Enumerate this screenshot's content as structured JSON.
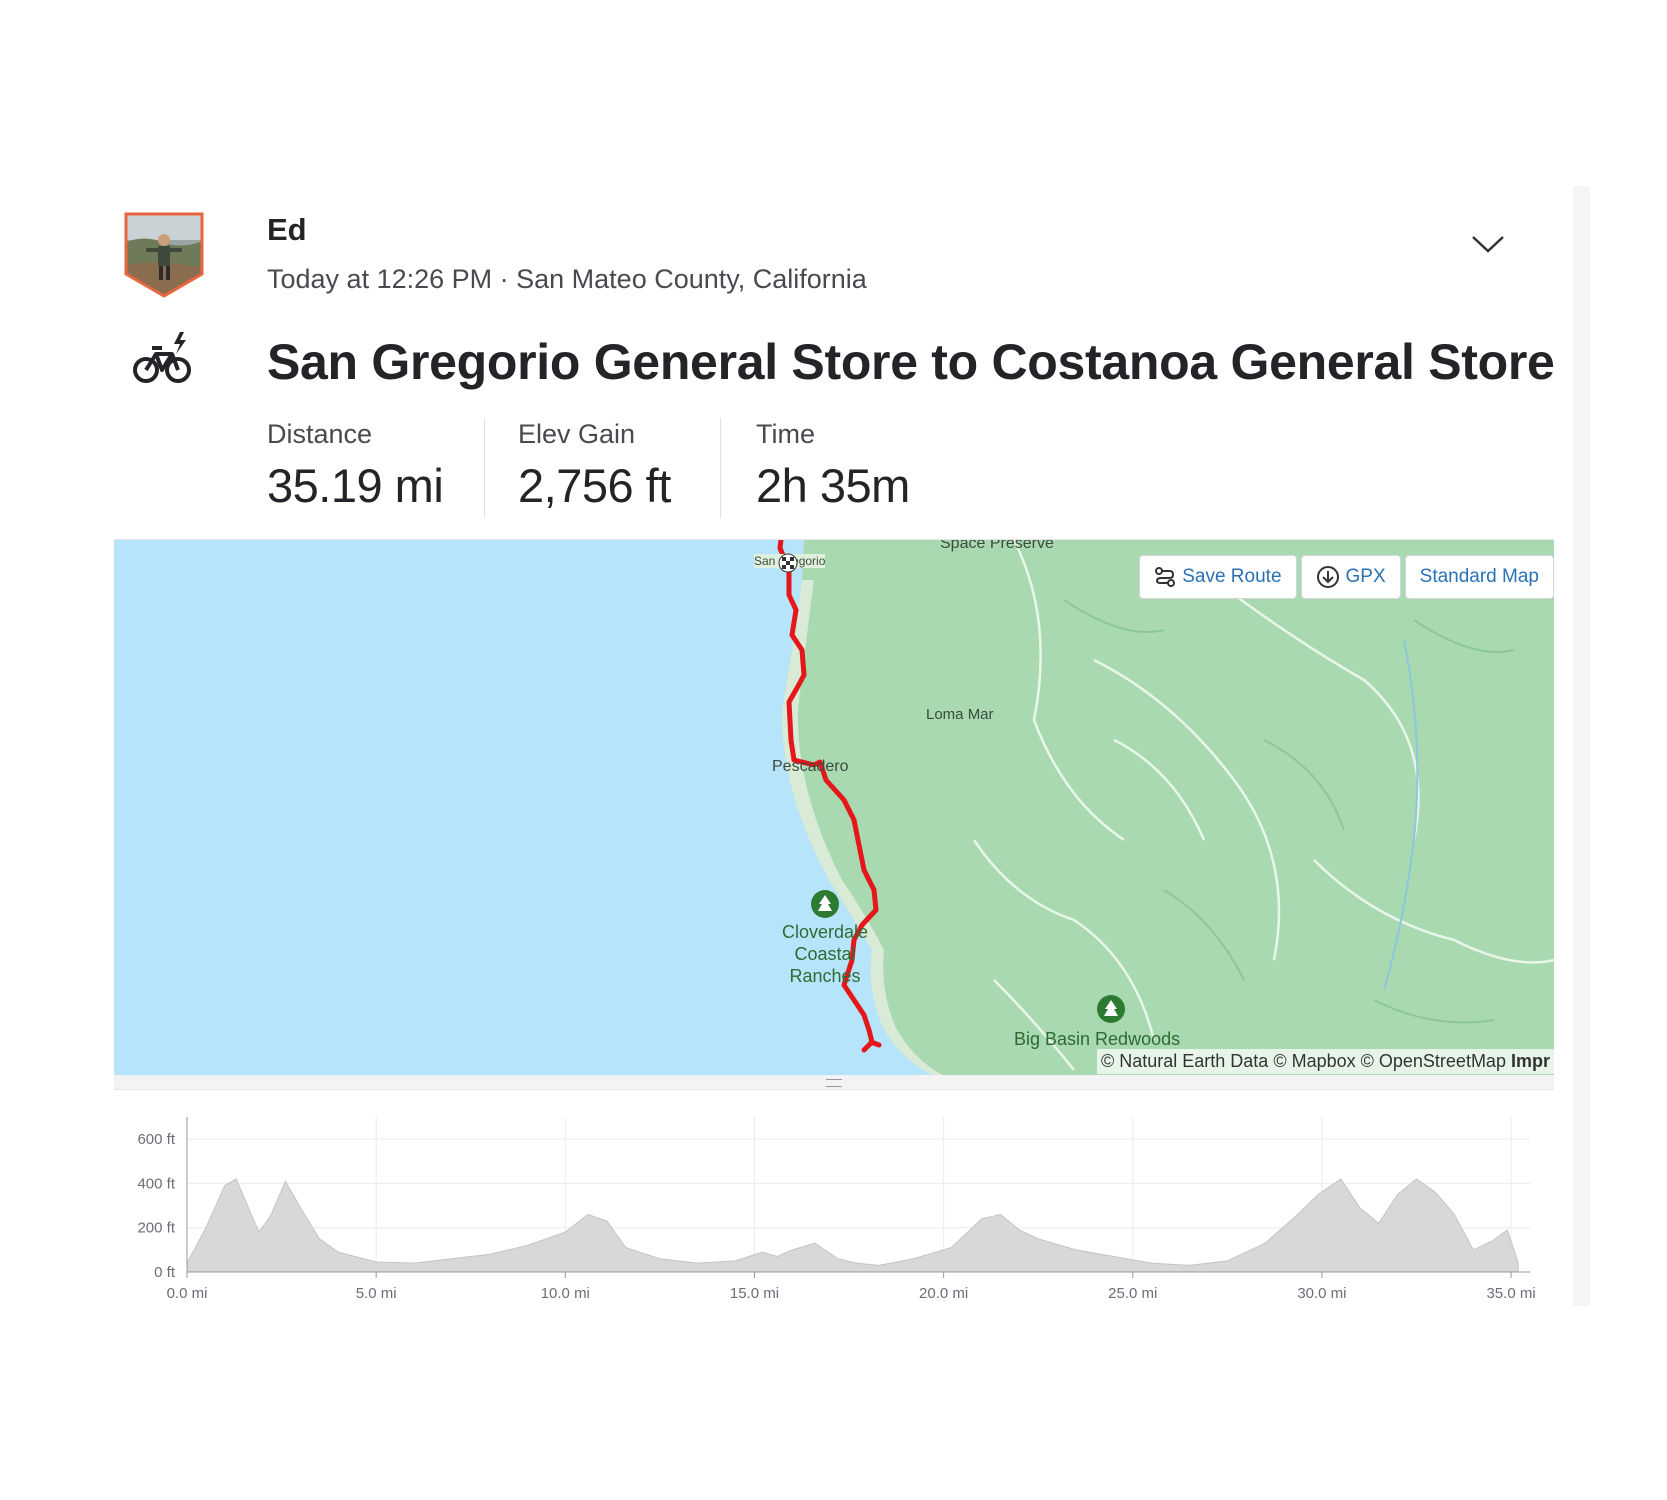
{
  "athlete": {
    "name": "Ed",
    "avatar": "athlete-avatar-photo"
  },
  "activity": {
    "meta": "Today at 12:26 PM · San Mateo County, California",
    "sport_icon": "ebike-icon",
    "title": "San Gregorio General Store to Costanoa General Store"
  },
  "stats": [
    {
      "label": "Distance",
      "value": "35.19 mi"
    },
    {
      "label": "Elev Gain",
      "value": "2,756 ft"
    },
    {
      "label": "Time",
      "value": "2h 35m"
    }
  ],
  "map": {
    "buttons": {
      "save_route": "Save Route",
      "gpx": "GPX",
      "standard_map": "Standard Map"
    },
    "labels": {
      "space_preserve": "Space Preserve",
      "san_gregorio": "San Gregorio",
      "loma_mar": "Loma Mar",
      "pescadero": "Pescadero",
      "cloverdale": "Cloverdale Coastal Ranches",
      "big_basin": "Big Basin Redwoods"
    },
    "attribution": "© Natural Earth Data © Mapbox © OpenStreetMap",
    "attribution_more": "Impr",
    "colors": {
      "ocean": "#b6e4fa",
      "land": "#a8d9b1",
      "route": "#e4171b"
    }
  },
  "chart_data": {
    "type": "area",
    "x_unit": "mi",
    "y_unit": "ft",
    "xlim": [
      0,
      35.19
    ],
    "ylim": [
      0,
      700
    ],
    "y_ticks": [
      "0 ft",
      "200 ft",
      "400 ft",
      "600 ft"
    ],
    "x_ticks": [
      "0.0 mi",
      "5.0 mi",
      "10.0 mi",
      "15.0 mi",
      "20.0 mi",
      "25.0 mi",
      "30.0 mi",
      "35.0 mi"
    ],
    "y_tick_values": [
      0,
      200,
      400,
      600
    ],
    "x_tick_values": [
      0,
      5,
      10,
      15,
      20,
      25,
      30,
      35
    ],
    "grid": true,
    "x": [
      0,
      0.5,
      1,
      1.3,
      1.6,
      1.9,
      2.2,
      2.6,
      3.0,
      3.5,
      4,
      5,
      6,
      7,
      8,
      9,
      10,
      10.6,
      11.1,
      11.6,
      12.5,
      13.5,
      14.5,
      15.2,
      15.6,
      16,
      16.6,
      17.2,
      17.7,
      18.3,
      19.2,
      20.2,
      21,
      21.5,
      22,
      22.5,
      23.5,
      24.5,
      25.5,
      26.5,
      27.5,
      28.5,
      29.3,
      29.9,
      30.5,
      31.0,
      31.5,
      32.0,
      32.5,
      33.0,
      33.5,
      34.0,
      34.5,
      34.9,
      35.19
    ],
    "y": [
      40,
      200,
      390,
      420,
      300,
      180,
      250,
      410,
      290,
      150,
      90,
      45,
      40,
      60,
      80,
      120,
      180,
      260,
      230,
      110,
      60,
      40,
      50,
      90,
      70,
      100,
      130,
      60,
      40,
      30,
      60,
      110,
      240,
      260,
      190,
      150,
      100,
      70,
      40,
      30,
      50,
      130,
      250,
      350,
      420,
      290,
      220,
      350,
      420,
      360,
      260,
      100,
      140,
      190,
      40
    ]
  }
}
